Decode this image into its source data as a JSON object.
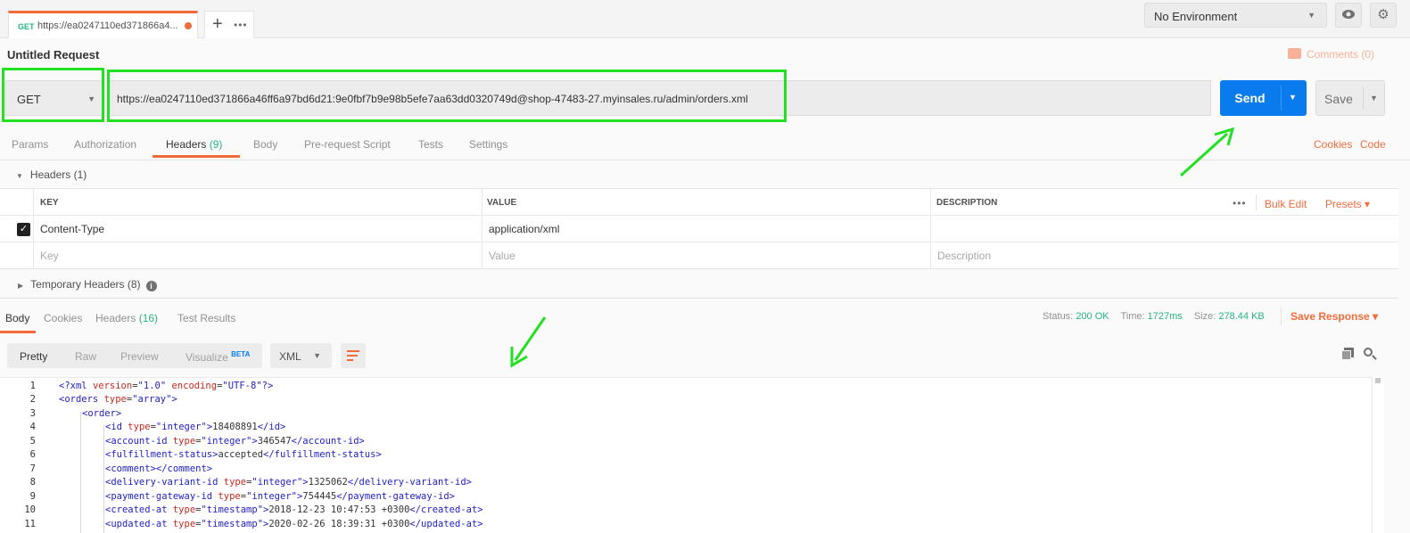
{
  "tab": {
    "method": "GET",
    "title": "https://ea0247110ed371866a4...",
    "add": "+",
    "more": "•••"
  },
  "environment": {
    "selected": "No Environment"
  },
  "request": {
    "title": "Untitled Request",
    "comments": "Comments (0)",
    "method": "GET",
    "url": "https://ea0247110ed371866a46ff6a97bd6d21:9e0fbf7b9e98b5efe7aa63dd0320749d@shop-47483-27.myinsales.ru/admin/orders.xml",
    "send": "Send",
    "save": "Save"
  },
  "request_tabs": {
    "params": "Params",
    "authorization": "Authorization",
    "headers": "Headers",
    "headers_count": "(9)",
    "body": "Body",
    "pre_request": "Pre-request Script",
    "tests": "Tests",
    "settings": "Settings",
    "cookies": "Cookies",
    "code": "Code"
  },
  "headers_section": {
    "title": "Headers (1)",
    "columns": {
      "key": "KEY",
      "value": "VALUE",
      "description": "DESCRIPTION"
    },
    "more": "•••",
    "bulk_edit": "Bulk Edit",
    "presets": "Presets ▾",
    "rows": [
      {
        "key": "Content-Type",
        "value": "application/xml",
        "checked": true
      }
    ],
    "placeholders": {
      "key": "Key",
      "value": "Value",
      "description": "Description"
    },
    "temporary": "Temporary Headers (8)"
  },
  "response_tabs": {
    "body": "Body",
    "cookies": "Cookies",
    "headers": "Headers",
    "headers_count": "(16)",
    "test_results": "Test Results"
  },
  "response_status": {
    "status_label": "Status:",
    "status": "200 OK",
    "time_label": "Time:",
    "time": "1727ms",
    "size_label": "Size:",
    "size": "278.44 KB",
    "save_response": "Save Response ▾"
  },
  "view": {
    "pretty": "Pretty",
    "raw": "Raw",
    "preview": "Preview",
    "visualize": "Visualize",
    "beta": "BETA",
    "format": "XML"
  },
  "code_lines": [
    "1",
    "2",
    "3",
    "4",
    "5",
    "6",
    "7",
    "8",
    "9",
    "10",
    "11"
  ],
  "colors": {
    "accent": "#f26b3a",
    "send": "#097bed",
    "ok": "#26b47f",
    "highlight": "#22e022"
  }
}
